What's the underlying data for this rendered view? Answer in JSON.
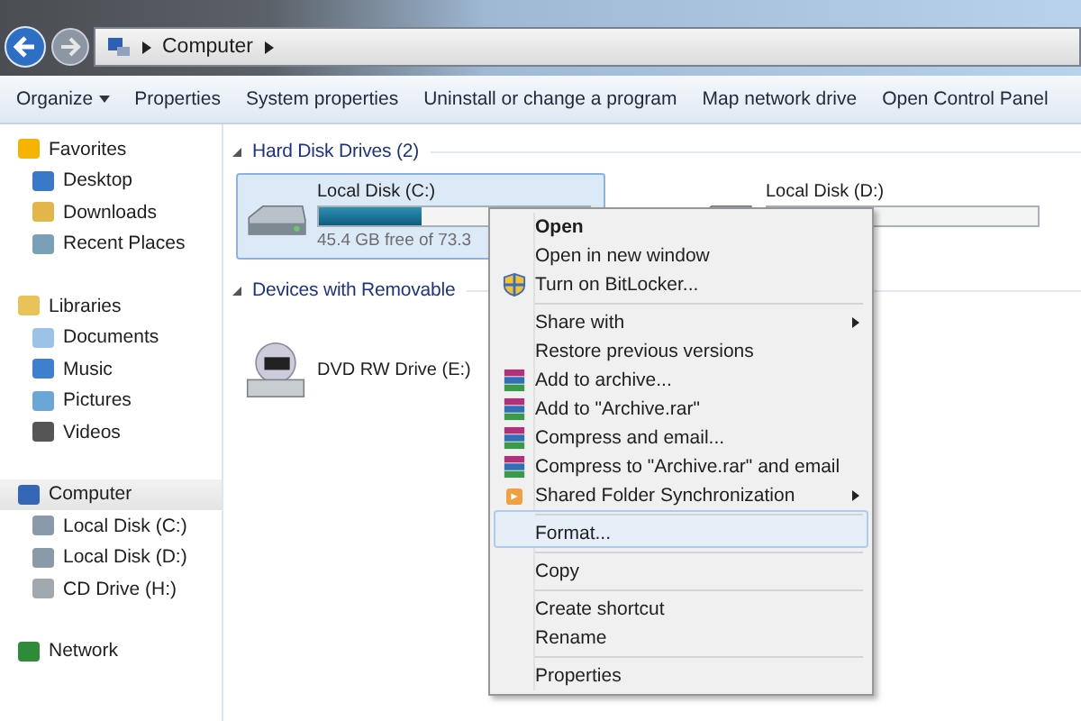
{
  "address_bar": {
    "path": [
      "Computer"
    ]
  },
  "toolbar": [
    {
      "label": "Organize",
      "dropdown": true
    },
    {
      "label": "Properties",
      "dropdown": false
    },
    {
      "label": "System properties",
      "dropdown": false
    },
    {
      "label": "Uninstall or change a program",
      "dropdown": false
    },
    {
      "label": "Map network drive",
      "dropdown": false
    },
    {
      "label": "Open Control Panel",
      "dropdown": false
    }
  ],
  "sidebar": {
    "groups": [
      {
        "label": "Favorites",
        "kind": "star",
        "selected": false,
        "children": [
          {
            "label": "Desktop",
            "kind": "desktop"
          },
          {
            "label": "Downloads",
            "kind": "folder"
          },
          {
            "label": "Recent Places",
            "kind": "recent"
          }
        ]
      },
      {
        "label": "Libraries",
        "kind": "library",
        "selected": false,
        "children": [
          {
            "label": "Documents",
            "kind": "doc"
          },
          {
            "label": "Music",
            "kind": "music"
          },
          {
            "label": "Pictures",
            "kind": "picture"
          },
          {
            "label": "Videos",
            "kind": "video"
          }
        ]
      },
      {
        "label": "Computer",
        "kind": "computer",
        "selected": true,
        "children": [
          {
            "label": "Local Disk (C:)",
            "kind": "hdd"
          },
          {
            "label": "Local Disk (D:)",
            "kind": "hdd"
          },
          {
            "label": "CD Drive (H:)",
            "kind": "cd"
          }
        ]
      },
      {
        "label": "Network",
        "kind": "network",
        "selected": false
      }
    ]
  },
  "sections": [
    {
      "title": "Hard Disk Drives (2)",
      "drives": [
        {
          "name": "Local Disk (C:)",
          "kind": "hdd",
          "selected": true,
          "level": 0.38,
          "detail": "45.4 GB free of 73.3"
        },
        {
          "name": "Local Disk (D:)",
          "kind": "hdd",
          "selected": false,
          "level": 0
        }
      ]
    },
    {
      "title": "Devices with Removable",
      "drives": [
        {
          "name": "DVD RW Drive (E:)",
          "kind": "dvd",
          "selected": false
        }
      ]
    }
  ],
  "context_menu": [
    {
      "label": "Open",
      "kind": "plain",
      "default": true,
      "submenu": false,
      "separator_before": false,
      "selected": false
    },
    {
      "label": "Open in new window",
      "kind": "plain",
      "default": false,
      "submenu": false,
      "separator_before": false,
      "selected": false
    },
    {
      "label": "Turn on BitLocker...",
      "kind": "shield",
      "default": false,
      "submenu": false,
      "separator_before": false,
      "selected": false
    },
    {
      "label": "Share with",
      "kind": "plain",
      "default": false,
      "submenu": true,
      "separator_before": true,
      "selected": false
    },
    {
      "label": "Restore previous versions",
      "kind": "plain",
      "default": false,
      "submenu": false,
      "separator_before": false,
      "selected": false
    },
    {
      "label": "Add to archive...",
      "kind": "archive",
      "default": false,
      "submenu": false,
      "separator_before": false,
      "selected": false
    },
    {
      "label": "Add to \"Archive.rar\"",
      "kind": "archive",
      "default": false,
      "submenu": false,
      "separator_before": false,
      "selected": false
    },
    {
      "label": "Compress and email...",
      "kind": "archive",
      "default": false,
      "submenu": false,
      "separator_before": false,
      "selected": false
    },
    {
      "label": "Compress to \"Archive.rar\" and email",
      "kind": "archive",
      "default": false,
      "submenu": false,
      "separator_before": false,
      "selected": false
    },
    {
      "label": "Shared Folder Synchronization",
      "kind": "sync",
      "default": false,
      "submenu": true,
      "separator_before": false,
      "selected": false
    },
    {
      "label": "Format...",
      "kind": "plain",
      "default": false,
      "submenu": false,
      "separator_before": true,
      "selected": true
    },
    {
      "label": "Copy",
      "kind": "plain",
      "default": false,
      "submenu": false,
      "separator_before": true,
      "selected": false
    },
    {
      "label": "Create shortcut",
      "kind": "plain",
      "default": false,
      "submenu": false,
      "separator_before": true,
      "selected": false
    },
    {
      "label": "Rename",
      "kind": "plain",
      "default": false,
      "submenu": false,
      "separator_before": false,
      "selected": false
    },
    {
      "label": "Properties",
      "kind": "plain",
      "default": false,
      "submenu": false,
      "separator_before": true,
      "selected": false
    }
  ]
}
